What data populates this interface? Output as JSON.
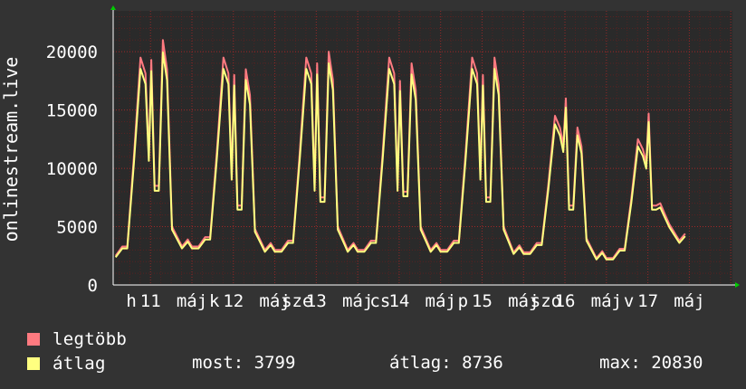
{
  "colors": {
    "background": "#333333",
    "plot_background": "#2a2a2a",
    "grid": "#6b1f1f",
    "axis": "#ffffff",
    "arrow": "#00cc00",
    "max_series": "#ff7a80",
    "avg_series": "#ffff80"
  },
  "legend": {
    "max_label": "legtöbb",
    "avg_label": "átlag"
  },
  "stats": {
    "current": "most: 3799",
    "average": "átlag: 8736",
    "maximum": "max: 20830"
  },
  "chart_data": {
    "type": "line",
    "ylabel": "onlinestream.live",
    "ylim": [
      0,
      23500
    ],
    "yticks": [
      0,
      5000,
      10000,
      15000,
      20000
    ],
    "xlim": [
      10.55,
      18.02
    ],
    "xtick_labels": [
      {
        "x": 10.77,
        "label": "h"
      },
      {
        "x": 11.0,
        "label": "11"
      },
      {
        "x": 11.5,
        "label": "máj"
      },
      {
        "x": 11.77,
        "label": "k"
      },
      {
        "x": 12.0,
        "label": "12"
      },
      {
        "x": 12.5,
        "label": "máj"
      },
      {
        "x": 12.77,
        "label": "sze"
      },
      {
        "x": 13.0,
        "label": "13"
      },
      {
        "x": 13.5,
        "label": "máj"
      },
      {
        "x": 13.77,
        "label": "cs"
      },
      {
        "x": 14.0,
        "label": "14"
      },
      {
        "x": 14.5,
        "label": "máj"
      },
      {
        "x": 14.77,
        "label": "p"
      },
      {
        "x": 15.0,
        "label": "15"
      },
      {
        "x": 15.5,
        "label": "máj"
      },
      {
        "x": 15.77,
        "label": "szo"
      },
      {
        "x": 16.0,
        "label": "16"
      },
      {
        "x": 16.5,
        "label": "máj"
      },
      {
        "x": 16.77,
        "label": "v"
      },
      {
        "x": 17.0,
        "label": "17"
      },
      {
        "x": 17.5,
        "label": "máj"
      }
    ],
    "day_profiles": [
      {
        "day": 11,
        "start": 2500,
        "p1": 19500,
        "dip1": 11200,
        "p2": 19300,
        "dip2": 8500,
        "p3": 21000,
        "dip3": 5000,
        "end": 3300
      },
      {
        "day": 12,
        "start": 3300,
        "p1": 19500,
        "dip1": 9500,
        "p2": 18000,
        "dip2": 6800,
        "p3": 18500,
        "dip3": 4800,
        "end": 3000
      },
      {
        "day": 13,
        "start": 3000,
        "p1": 19500,
        "dip1": 8500,
        "p2": 19000,
        "dip2": 7500,
        "p3": 20000,
        "dip3": 5000,
        "end": 3000
      },
      {
        "day": 14,
        "start": 3000,
        "p1": 19500,
        "dip1": 8500,
        "p2": 17500,
        "dip2": 8000,
        "p3": 19000,
        "dip3": 5000,
        "end": 3000
      },
      {
        "day": 15,
        "start": 3000,
        "p1": 19500,
        "dip1": 9500,
        "p2": 18000,
        "dip2": 7500,
        "p3": 19500,
        "dip3": 5000,
        "end": 2800
      },
      {
        "day": 16,
        "start": 2800,
        "p1": 14500,
        "dip1": 12000,
        "p2": 16000,
        "dip2": 6800,
        "p3": 13500,
        "dip3": 4000,
        "end": 2300
      },
      {
        "day": 17,
        "start": 2300,
        "p1": 12500,
        "dip1": 10500,
        "p2": 14700,
        "dip2": 6800,
        "p3": 7000,
        "dip3": 5200,
        "end": 3800
      }
    ]
  }
}
